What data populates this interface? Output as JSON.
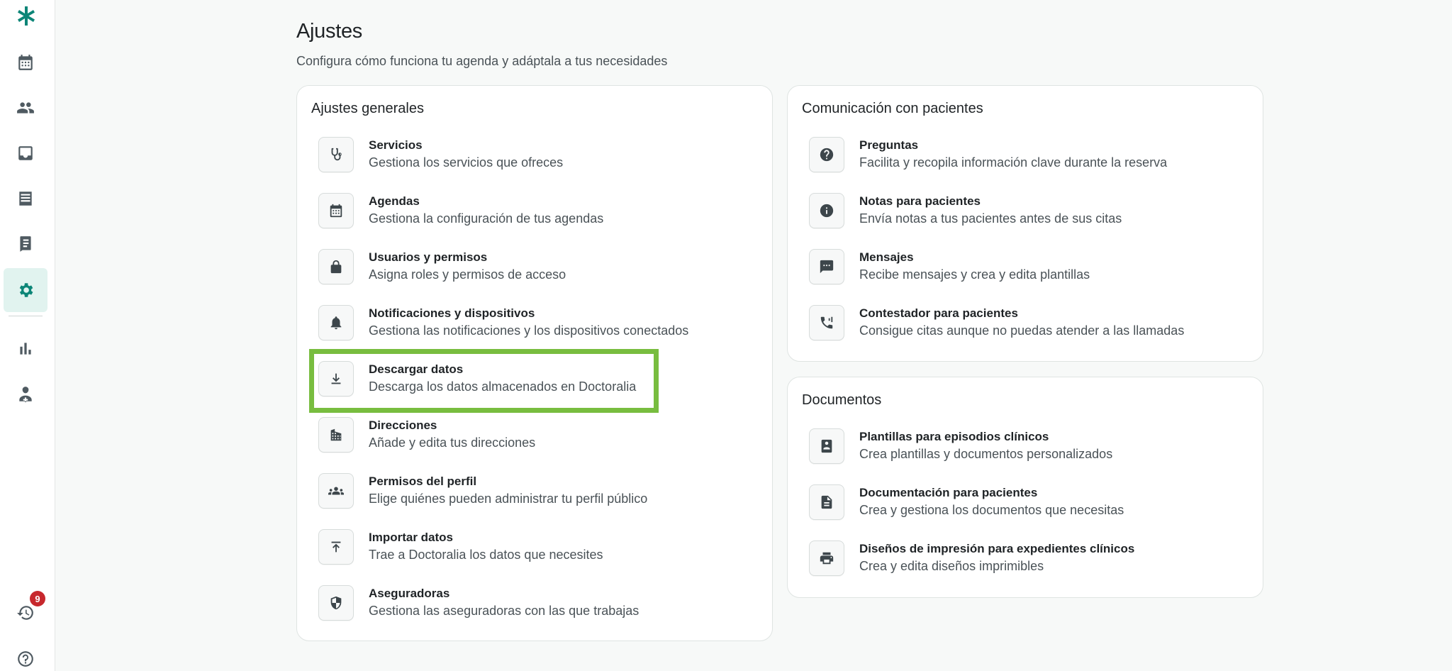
{
  "sidebar": {
    "items": [
      {
        "name": "logo-icon"
      },
      {
        "name": "calendar-icon"
      },
      {
        "name": "patients-icon"
      },
      {
        "name": "inbox-icon"
      },
      {
        "name": "list-icon"
      },
      {
        "name": "document-icon"
      },
      {
        "name": "gear-icon",
        "active": true
      },
      {
        "name": "bar-chart-icon"
      },
      {
        "name": "doctor-icon"
      },
      {
        "name": "history-icon"
      },
      {
        "name": "help-icon"
      }
    ],
    "notification_badge": "9"
  },
  "header": {
    "title": "Ajustes",
    "subtitle": "Configura cómo funciona tu agenda y adáptala a tus necesidades"
  },
  "general": {
    "title": "Ajustes generales",
    "items": [
      {
        "icon": "stethoscope-icon",
        "title": "Servicios",
        "desc": "Gestiona los servicios que ofreces"
      },
      {
        "icon": "calendar-icon",
        "title": "Agendas",
        "desc": "Gestiona la configuración de tus agendas"
      },
      {
        "icon": "lock-icon",
        "title": "Usuarios y permisos",
        "desc": "Asigna roles y permisos de acceso"
      },
      {
        "icon": "bell-icon",
        "title": "Notificaciones y dispositivos",
        "desc": "Gestiona las notificaciones y los dispositivos conectados"
      },
      {
        "icon": "download-icon",
        "title": "Descargar datos",
        "desc": "Descarga los datos almacenados en Doctoralia"
      },
      {
        "icon": "building-icon",
        "title": "Direcciones",
        "desc": "Añade y edita tus direcciones"
      },
      {
        "icon": "group-icon",
        "title": "Permisos del perfil",
        "desc": "Elige quiénes pueden administrar tu perfil público"
      },
      {
        "icon": "upload-icon",
        "title": "Importar datos",
        "desc": "Trae a Doctoralia los datos que necesites"
      },
      {
        "icon": "shield-icon",
        "title": "Aseguradoras",
        "desc": "Gestiona las aseguradoras con las que trabajas"
      }
    ]
  },
  "communication": {
    "title": "Comunicación con pacientes",
    "items": [
      {
        "icon": "question-icon",
        "title": "Preguntas",
        "desc": "Facilita y recopila información clave durante la reserva"
      },
      {
        "icon": "info-icon",
        "title": "Notas para pacientes",
        "desc": "Envía notas a tus pacientes antes de sus citas"
      },
      {
        "icon": "message-icon",
        "title": "Mensajes",
        "desc": "Recibe mensajes y crea y edita plantillas"
      },
      {
        "icon": "phone-icon",
        "title": "Contestador para pacientes",
        "desc": "Consigue citas aunque no puedas atender a las llamadas"
      }
    ]
  },
  "documents": {
    "title": "Documentos",
    "items": [
      {
        "icon": "contact-book-icon",
        "title": "Plantillas para episodios clínicos",
        "desc": "Crea plantillas y documentos personalizados"
      },
      {
        "icon": "file-icon",
        "title": "Documentación para pacientes",
        "desc": "Crea y gestiona los documentos que necesitas"
      },
      {
        "icon": "printer-icon",
        "title": "Diseños de impresión para expedientes clínicos",
        "desc": "Crea y edita diseños imprimibles"
      }
    ]
  },
  "highlight_color": "#78bd3f",
  "accent_color": "#0c8577"
}
